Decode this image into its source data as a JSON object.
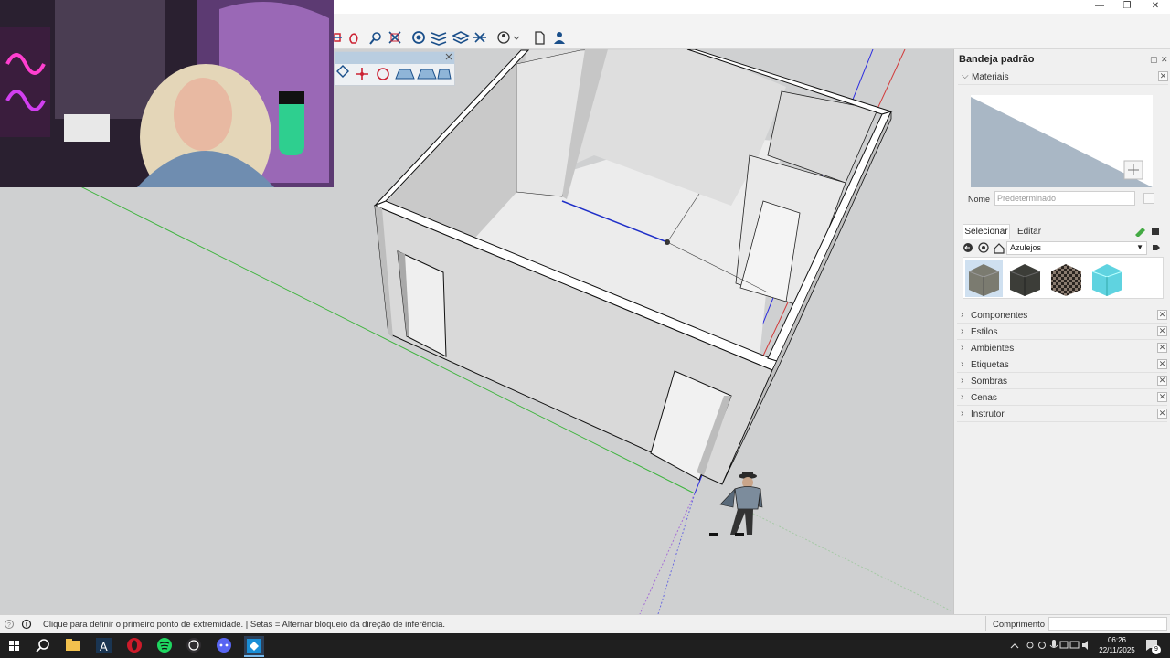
{
  "window": {
    "minimize_glyph": "—",
    "restore_glyph": "❐",
    "close_glyph": "✕"
  },
  "tray": {
    "title": "Bandeja padrão",
    "materials": {
      "header": "Materiais",
      "name_label": "Nome",
      "name_placeholder": "Predeterminado",
      "tabs": {
        "select": "Selecionar",
        "edit": "Editar"
      },
      "library": "Azulejos",
      "swatches": [
        {
          "icon": "stone-tile-swatch",
          "color": "#7b7b70"
        },
        {
          "icon": "dark-slate-swatch",
          "color": "#3c3d38"
        },
        {
          "icon": "checker-tile-swatch",
          "color": "#5a4f47"
        },
        {
          "icon": "aqua-tile-swatch",
          "color": "#5fd3e0"
        }
      ]
    },
    "sections": [
      {
        "label": "Componentes"
      },
      {
        "label": "Estilos"
      },
      {
        "label": "Ambientes"
      },
      {
        "label": "Etiquetas"
      },
      {
        "label": "Sombras"
      },
      {
        "label": "Cenas"
      },
      {
        "label": "Instrutor"
      }
    ]
  },
  "status": {
    "message": "Clique para definir o primeiro ponto de extremidade. | Setas = Alternar bloqueio da direção de inferência.",
    "measure_label": "Comprimento",
    "measure_value": ""
  },
  "taskbar": {
    "time": "06:26",
    "date": "22/11/2025",
    "notifications": "9"
  },
  "colors": {
    "viewport_bg": "#cfd0d1",
    "green_axis": "#3bb33b",
    "blue_axis": "#2a2ae0",
    "red_axis": "#d23a3a",
    "accent": "#1a6fc0"
  }
}
